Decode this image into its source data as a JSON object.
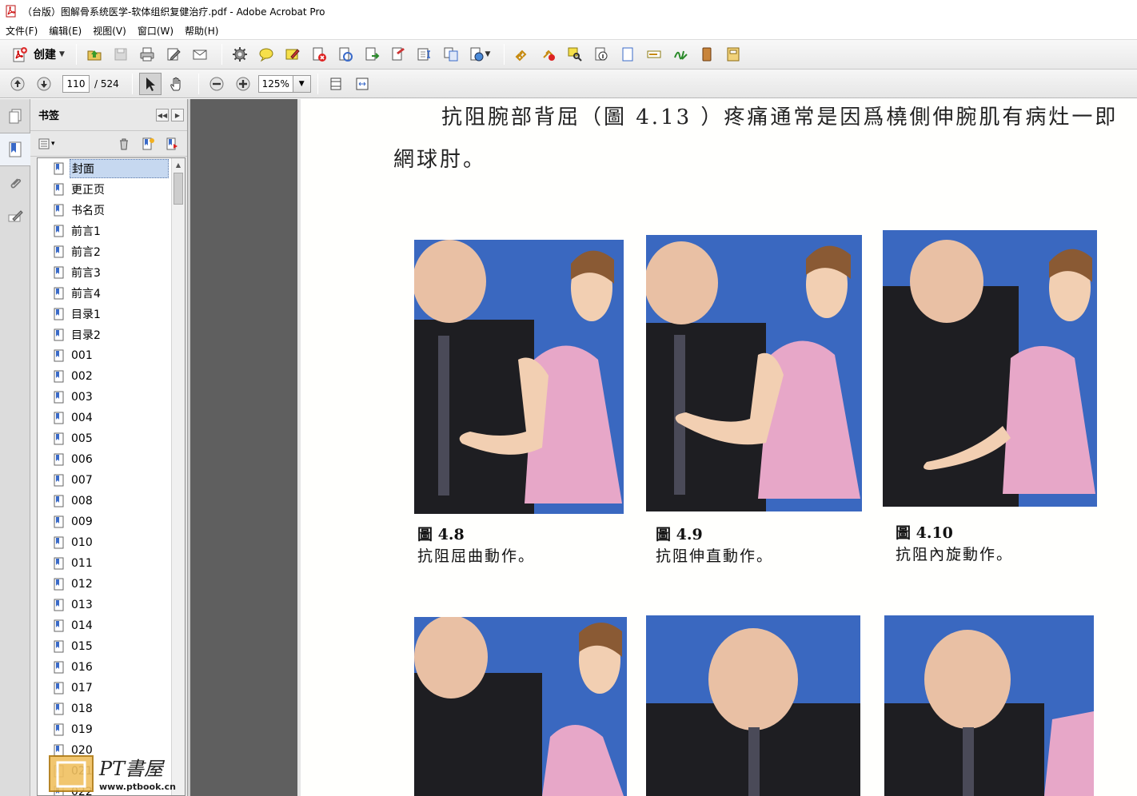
{
  "window": {
    "title": "（台版）图解骨系统医学-软体组织复健治疗.pdf - Adobe Acrobat Pro"
  },
  "menu": [
    "文件(F)",
    "编辑(E)",
    "视图(V)",
    "窗口(W)",
    "帮助(H)"
  ],
  "toolbar": {
    "create_label": "创建"
  },
  "nav": {
    "current_page": "110",
    "total_pages": "/ 524",
    "zoom": "125%"
  },
  "bookmarks": {
    "title": "书签",
    "items": [
      "封面",
      "更正页",
      "书名页",
      "前言1",
      "前言2",
      "前言3",
      "前言4",
      "目录1",
      "目录2",
      "001",
      "002",
      "003",
      "004",
      "005",
      "006",
      "007",
      "008",
      "009",
      "010",
      "011",
      "012",
      "013",
      "014",
      "015",
      "016",
      "017",
      "018",
      "019",
      "020",
      "021",
      "022"
    ]
  },
  "document": {
    "text_line1": "抗阻腕部背屈（圖 4.13 ）疼痛通常是因爲橈側伸腕肌有病灶一即",
    "text_line2": "網球肘。",
    "figures": [
      {
        "number": "圖 4.8",
        "caption": "抗阻屈曲動作。"
      },
      {
        "number": "圖 4.9",
        "caption": "抗阻伸直動作。"
      },
      {
        "number": "圖 4.10",
        "caption": "抗阻內旋動作。"
      }
    ]
  },
  "watermark": {
    "text": "PT書屋",
    "url": "www.ptbook.cn"
  },
  "colors": {
    "photo_background": "#2f5db0",
    "leotard": "#e7a7c8",
    "selection": "#c6d8f0"
  }
}
